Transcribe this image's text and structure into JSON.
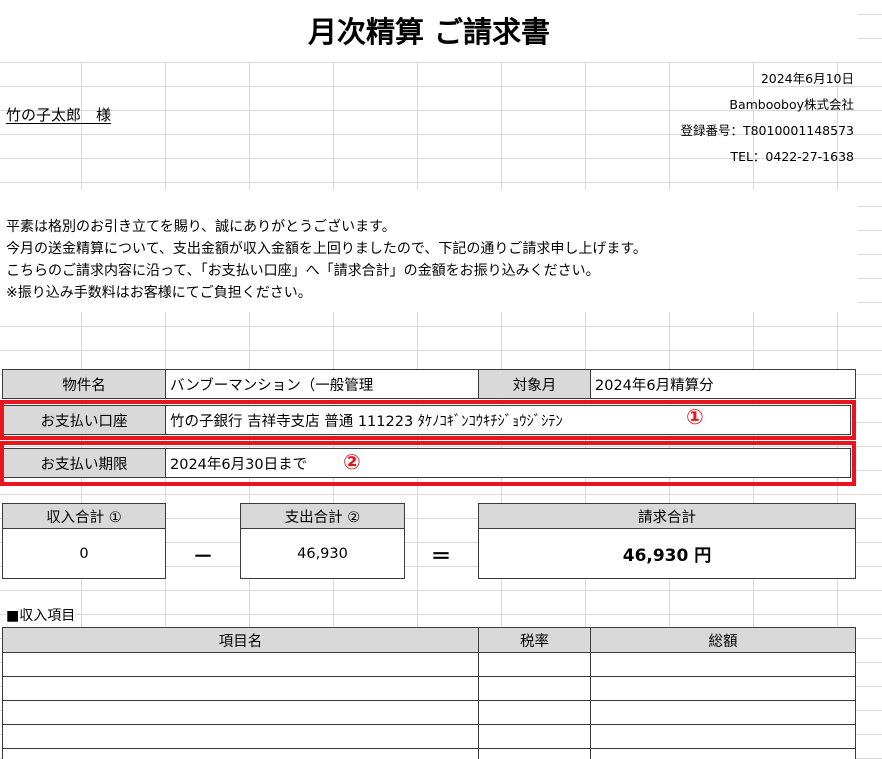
{
  "document": {
    "title": "月次精算 ご請求書",
    "date": "2024年6月10日",
    "company": "Bambooboy株式会社",
    "registration": "登録番号：T8010001148573",
    "tel": "TEL：0422-27-1638",
    "customer": "竹の子太郎　様",
    "message": [
      "平素は格別のお引き立てを賜り、誠にありがとうございます。",
      "今月の送金精算について、支出金額が収入金額を上回りましたので、下記の通りご請求申し上げます。",
      "こちらのご請求内容に沿って、「お支払い口座」へ「請求合計」の金額をお振り込みください。",
      "※振り込み手数料はお客様にてご負担ください。"
    ]
  },
  "info": {
    "property_label": "物件名",
    "property_value": "バンブーマンション（一般管理",
    "month_label": "対象月",
    "month_value": "2024年6月精算分",
    "account_label": "お支払い口座",
    "account_value": "竹の子銀行 吉祥寺支店 普通 111223 ﾀｹﾉｺｷﾞﾝｺｳｷﾁｼﾞｮｳｼﾞｼﾃﾝ",
    "deadline_label": "お支払い期限",
    "deadline_value": "2024年6月30日まで"
  },
  "annotations": {
    "marker1": "①",
    "marker2": "②"
  },
  "totals": {
    "income_label": "収入合計 ①",
    "income_value": "0",
    "minus": "－",
    "expense_label": "支出合計 ②",
    "expense_value": "46,930",
    "equals": "＝",
    "billing_label": "請求合計",
    "billing_value": "46,930 円"
  },
  "income_section": {
    "title": "■収入項目",
    "columns": [
      "項目名",
      "税率",
      "総額"
    ]
  },
  "colors": {
    "highlight": "#e8141e",
    "header_bg": "#d9d9d9"
  }
}
